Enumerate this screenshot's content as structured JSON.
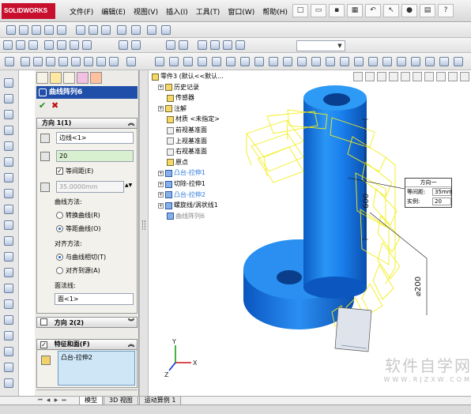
{
  "app": {
    "logo_text": "SOLIDWORKS"
  },
  "menu": [
    "文件(F)",
    "编辑(E)",
    "视图(V)",
    "插入(I)",
    "工具(T)",
    "窗口(W)",
    "帮助(H)"
  ],
  "property_manager": {
    "title": "曲线阵列6",
    "direction1": {
      "header": "方向 1(1)",
      "edge_field": "边线<1>",
      "instances": "20",
      "equal_spacing_label": "等间距(E)",
      "equal_spacing_checked": true,
      "spacing": "35.0000mm",
      "curve_method_label": "曲线方法:",
      "curve_method_options": [
        {
          "label": "转换曲线(R)",
          "selected": false
        },
        {
          "label": "等距曲线(O)",
          "selected": true
        }
      ],
      "align_method_label": "对齐方法:",
      "align_method_options": [
        {
          "label": "与曲线相切(T)",
          "selected": true
        },
        {
          "label": "对齐到源(A)",
          "selected": false
        }
      ],
      "face_normal_label": "面法线:",
      "face_field": "面<1>"
    },
    "direction2": {
      "header": "方向 2(2)",
      "checked": false
    },
    "features_faces": {
      "header": "特征和面(F)",
      "checked": true,
      "items": [
        "凸台-拉伸2"
      ]
    }
  },
  "tree": {
    "items": [
      {
        "label": "零件3 (默认<<默认...",
        "style": "normal",
        "indent": 0,
        "icon": "part",
        "expander": ""
      },
      {
        "label": "历史记录",
        "style": "normal",
        "indent": 1,
        "icon": "history",
        "expander": "+"
      },
      {
        "label": "传感器",
        "style": "normal",
        "indent": 1,
        "icon": "sensor",
        "expander": ""
      },
      {
        "label": "注解",
        "style": "normal",
        "indent": 1,
        "icon": "annotation",
        "expander": "+"
      },
      {
        "label": "材质 <未指定>",
        "style": "normal",
        "indent": 1,
        "icon": "material",
        "expander": ""
      },
      {
        "label": "前视基准面",
        "style": "normal",
        "indent": 1,
        "icon": "plane",
        "expander": ""
      },
      {
        "label": "上视基准面",
        "style": "normal",
        "indent": 1,
        "icon": "plane",
        "expander": ""
      },
      {
        "label": "右视基准面",
        "style": "normal",
        "indent": 1,
        "icon": "plane",
        "expander": ""
      },
      {
        "label": "原点",
        "style": "normal",
        "indent": 1,
        "icon": "origin",
        "expander": ""
      },
      {
        "label": "凸台-拉伸1",
        "style": "blue",
        "indent": 1,
        "icon": "feature",
        "expander": "+"
      },
      {
        "label": "切除-拉伸1",
        "style": "normal",
        "indent": 1,
        "icon": "feature",
        "expander": "+"
      },
      {
        "label": "凸台-拉伸2",
        "style": "blue",
        "indent": 1,
        "icon": "feature",
        "expander": "+"
      },
      {
        "label": "螺旋线/涡状线1",
        "style": "normal",
        "indent": 1,
        "icon": "helix",
        "expander": "+"
      },
      {
        "label": "曲线阵列6",
        "style": "gray",
        "indent": 1,
        "icon": "pattern",
        "expander": ""
      }
    ]
  },
  "callout": {
    "title": "方向一",
    "rows": [
      {
        "label": "等间距:",
        "value": "35mm"
      },
      {
        "label": "实例:",
        "value": "20"
      }
    ]
  },
  "dimensions": {
    "height": "600",
    "diameter": "⌀200"
  },
  "triad": {
    "x": "X",
    "y": "Y",
    "z": "Z"
  },
  "watermark": {
    "big": "软件自学网",
    "small": "WWW.RJZXW.COM"
  },
  "bottom_tabs": [
    {
      "label": "模型",
      "active": true
    },
    {
      "label": "3D 视图",
      "active": false
    },
    {
      "label": "运动算例 1",
      "active": false
    }
  ],
  "colors": {
    "cylinder": "#1e78e6",
    "preview": "#f4f21a",
    "title_bar": "#1f4fa8",
    "selection": "#cfe6f7"
  }
}
